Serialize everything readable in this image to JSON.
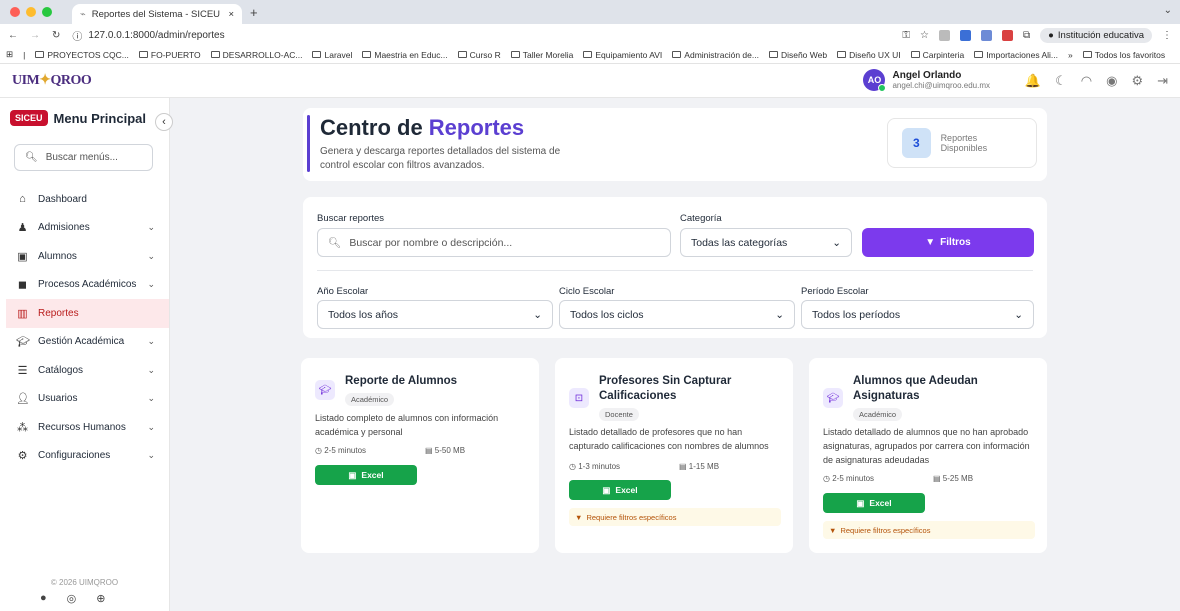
{
  "browser": {
    "tab_title": "Reportes del Sistema - SICEU",
    "url": "127.0.0.1:8000/admin/reportes",
    "profile": "Institución educativa",
    "bookmarks": [
      "PROYECTOS CQC...",
      "FO-PUERTO",
      "DESARROLLO-AC...",
      "Laravel",
      "Maestria en Educ...",
      "Curso R",
      "Taller Morelia",
      "Equipamiento AVI",
      "Administración de...",
      "Diseño Web",
      "Diseño UX UI",
      "Carpinteria",
      "Importaciones Ali..."
    ],
    "all_bookmarks": "Todos los favoritos"
  },
  "header": {
    "logo": "UIMQROO",
    "user_initials": "AO",
    "user_name": "Angel Orlando",
    "user_email": "angel.chi@uimqroo.edu.mx"
  },
  "sidebar": {
    "brand": "SICEU",
    "title": "Menu Principal",
    "search_placeholder": "Buscar menús...",
    "items": [
      {
        "label": "Dashboard",
        "icon": "home-icon"
      },
      {
        "label": "Admisiones",
        "icon": "admissions-icon"
      },
      {
        "label": "Alumnos",
        "icon": "students-icon"
      },
      {
        "label": "Procesos Académicos",
        "icon": "processes-icon"
      },
      {
        "label": "Reportes",
        "icon": "chart-icon"
      },
      {
        "label": "Gestión Académica",
        "icon": "graduation-icon"
      },
      {
        "label": "Catálogos",
        "icon": "database-icon"
      },
      {
        "label": "Usuarios",
        "icon": "user-icon"
      },
      {
        "label": "Recursos Humanos",
        "icon": "people-icon"
      },
      {
        "label": "Configuraciones",
        "icon": "gear-icon"
      }
    ],
    "copyright": "© 2026 UIMQROO"
  },
  "hero": {
    "title_a": "Centro de ",
    "title_b": "Reportes",
    "subtitle": "Genera y descarga reportes detallados del sistema de control escolar con filtros avanzados.",
    "count": "3",
    "count_label": "Reportes Disponibles"
  },
  "filters": {
    "search_label": "Buscar reportes",
    "search_placeholder": "Buscar por nombre o descripción...",
    "category_label": "Categoría",
    "category_value": "Todas las categorías",
    "filters_button": "Filtros",
    "year_label": "Año Escolar",
    "year_value": "Todos los años",
    "cycle_label": "Ciclo Escolar",
    "cycle_value": "Todos los ciclos",
    "period_label": "Período Escolar",
    "period_value": "Todos los períodos"
  },
  "reports": [
    {
      "title": "Reporte de Alumnos",
      "badge": "Académico",
      "desc": "Listado completo de alumnos con información académica y personal",
      "time": "2-5 minutos",
      "size": "5-50 MB",
      "button": "Excel"
    },
    {
      "title": "Profesores Sin Capturar Calificaciones",
      "badge": "Docente",
      "desc": "Listado detallado de profesores que no han capturado calificaciones con nombres de alumnos",
      "time": "1-3 minutos",
      "size": "1-15 MB",
      "button": "Excel",
      "note": "Requiere filtros específicos"
    },
    {
      "title": "Alumnos que Adeudan Asignaturas",
      "badge": "Académico",
      "desc": "Listado detallado de alumnos que no han aprobado asignaturas, agrupados por carrera con información de asignaturas adeudadas",
      "time": "2-5 minutos",
      "size": "5-25 MB",
      "button": "Excel",
      "note": "Requiere filtros específicos"
    }
  ]
}
